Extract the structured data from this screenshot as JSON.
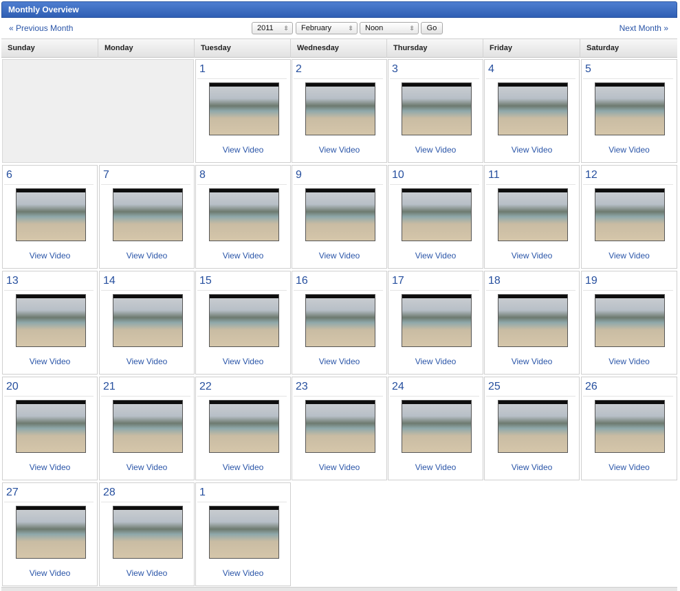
{
  "header": {
    "title": "Monthly Overview"
  },
  "nav": {
    "prev_label": "« Previous Month",
    "next_label": "Next Month »",
    "year": "2011",
    "month": "February",
    "time": "Noon",
    "go_label": "Go"
  },
  "weekdays": [
    "Sunday",
    "Monday",
    "Tuesday",
    "Wednesday",
    "Thursday",
    "Friday",
    "Saturday"
  ],
  "view_label": "View Video",
  "days": [
    "1",
    "2",
    "3",
    "4",
    "5",
    "6",
    "7",
    "8",
    "9",
    "10",
    "11",
    "12",
    "13",
    "14",
    "15",
    "16",
    "17",
    "18",
    "19",
    "20",
    "21",
    "22",
    "23",
    "24",
    "25",
    "26",
    "27",
    "28",
    "1"
  ]
}
